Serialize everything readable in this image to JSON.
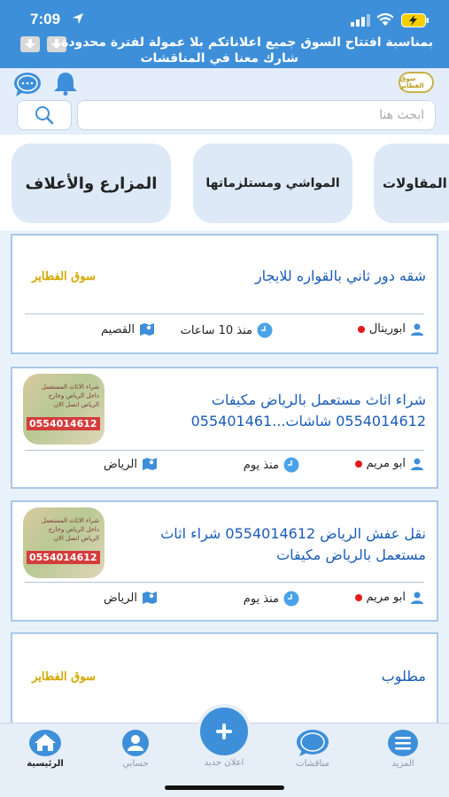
{
  "status_bar": {
    "time": "7:09"
  },
  "banner": {
    "line1": "بمناسبة افتتاح السوق  جميع اعلاناتكم بلا عمولة لفترة محدودة",
    "line2": "شارك معنا في المناقشات"
  },
  "header": {
    "logo_text": "سوق الفطاير",
    "search_placeholder": "ابحث هنا"
  },
  "categories": [
    {
      "label": "المقاولات"
    },
    {
      "label": "المواشي  ومستلزماتها"
    },
    {
      "label": "المزارع  والأعلاف"
    }
  ],
  "listings": [
    {
      "title": "شقه دور ثاني بالقواره للايجار",
      "user": "ابوريتال",
      "time": "منذ 10 ساعات",
      "location": "القصيم",
      "thumb_text": "سوق الفطاير"
    },
    {
      "title": "شراء اثاث مستعمل بالرياض مكيفات 0554014612 شاشات...055401461",
      "user": "ابو مريم",
      "time": "منذ يوم",
      "location": "الرياض",
      "thumb_phone": "0554014612",
      "thumb_caption": "شراء الاثاث المستعمل داخل الرياض وخارج الرياض اتصل الان"
    },
    {
      "title": "نقل عفش الرياض 0554014612 شراء اثاث مستعمل بالرياض مكيفات",
      "user": "ابو مريم",
      "time": "منذ يوم",
      "location": "الرياض",
      "thumb_phone": "0554014612",
      "thumb_caption": "شراء الاثاث المستعمل داخل الرياض وخارج الرياض اتصل الان"
    },
    {
      "title": "مطلوب",
      "thumb_text": "سوق الفطاير"
    }
  ],
  "tabbar": {
    "home": "الرئيسية",
    "account": "حسابي",
    "new_ad": "اعلان جديد",
    "discussions": "مناقشات",
    "more": "المزيد"
  },
  "colors": {
    "primary": "#3e8fd9",
    "title_blue": "#1a5cb8",
    "online_dot": "#e31b1b"
  }
}
